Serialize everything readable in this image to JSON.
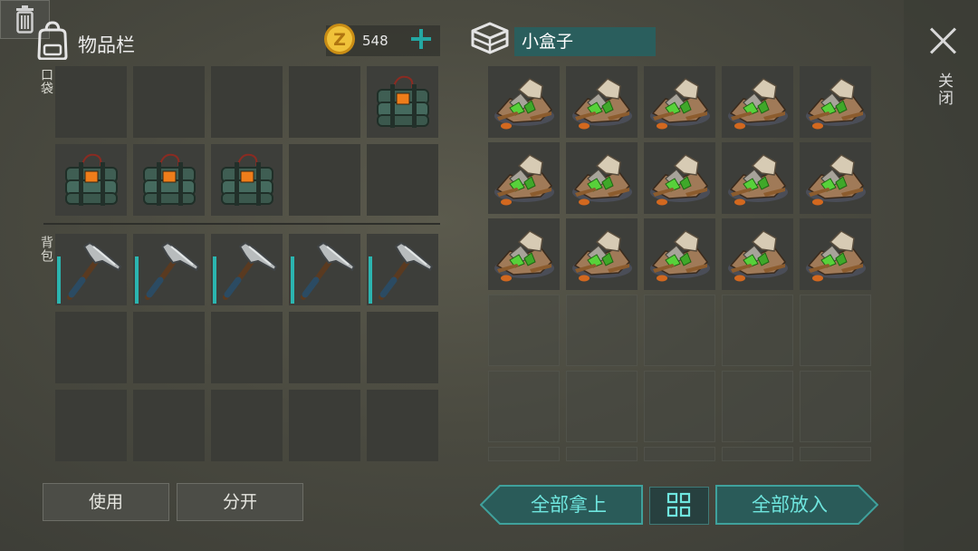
{
  "inventory": {
    "title": "物品栏",
    "pocket_label": "口袋",
    "backpack_label": "背包",
    "pocket_slots": [
      "",
      "",
      "",
      "",
      "c4-explosive",
      "c4-explosive",
      "c4-explosive",
      "c4-explosive",
      "",
      ""
    ],
    "backpack_slots": [
      "pickaxe",
      "pickaxe",
      "pickaxe",
      "pickaxe",
      "pickaxe",
      "",
      "",
      "",
      "",
      "",
      "",
      "",
      "",
      "",
      ""
    ]
  },
  "currency": {
    "amount": "548",
    "icon": "coin-icon",
    "color": "#e9b52c"
  },
  "box": {
    "name": "小盒子",
    "filled_count": 15,
    "item": "ore-pile",
    "visible_rows": 6
  },
  "close": {
    "label": "关闭"
  },
  "buttons": {
    "use": "使用",
    "split": "分开",
    "take_all": "全部拿上",
    "put_all": "全部放入"
  },
  "colors": {
    "accent": "#24a7a2",
    "button_text": "#6fe6df",
    "name_bg": "#2a5e5d"
  }
}
